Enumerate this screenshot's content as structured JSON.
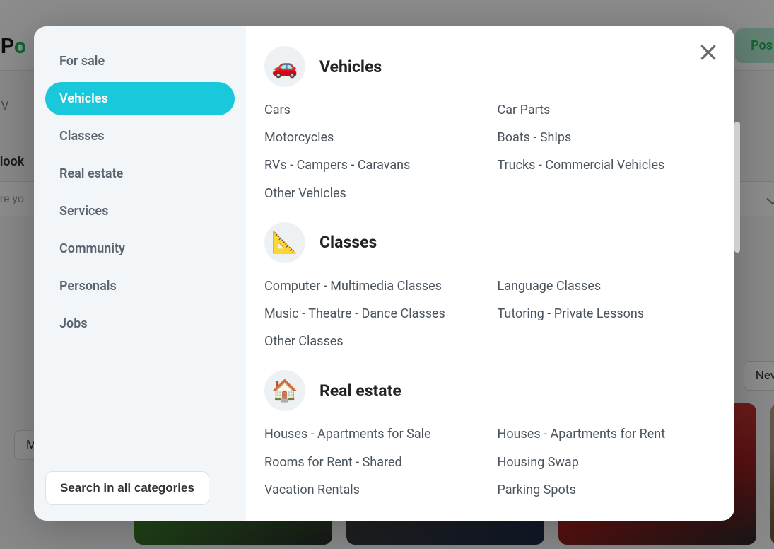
{
  "bg": {
    "logo_part1": "ssP",
    "logo_part2": "o",
    "post_btn": "Pos",
    "breadcrumb_sep": ">",
    "breadcrumb_item": "V",
    "search_label": "ou look",
    "search_placeholder": "are yo",
    "sort": "Nev",
    "dropdown": "M"
  },
  "modal": {
    "search_all": "Search in all categories",
    "sidebar": [
      {
        "label": "For sale",
        "active": false
      },
      {
        "label": "Vehicles",
        "active": true
      },
      {
        "label": "Classes",
        "active": false
      },
      {
        "label": "Real estate",
        "active": false
      },
      {
        "label": "Services",
        "active": false
      },
      {
        "label": "Community",
        "active": false
      },
      {
        "label": "Personals",
        "active": false
      },
      {
        "label": "Jobs",
        "active": false
      }
    ],
    "sections": [
      {
        "title": "Vehicles",
        "icon": "🚗",
        "items_left": [
          "Cars",
          "Motorcycles",
          "RVs - Campers - Caravans",
          "Other Vehicles"
        ],
        "items_right": [
          "Car Parts",
          "Boats - Ships",
          "Trucks - Commercial Vehicles"
        ]
      },
      {
        "title": "Classes",
        "icon": "📐",
        "items_left": [
          "Computer - Multimedia Classes",
          "Music - Theatre - Dance Classes",
          "Other Classes"
        ],
        "items_right": [
          "Language Classes",
          "Tutoring - Private Lessons"
        ]
      },
      {
        "title": "Real estate",
        "icon": "🏠",
        "items_left": [
          "Houses - Apartments for Sale",
          "Rooms for Rent - Shared",
          "Vacation Rentals"
        ],
        "items_right": [
          "Houses - Apartments for Rent",
          "Housing Swap",
          "Parking Spots"
        ]
      }
    ]
  }
}
